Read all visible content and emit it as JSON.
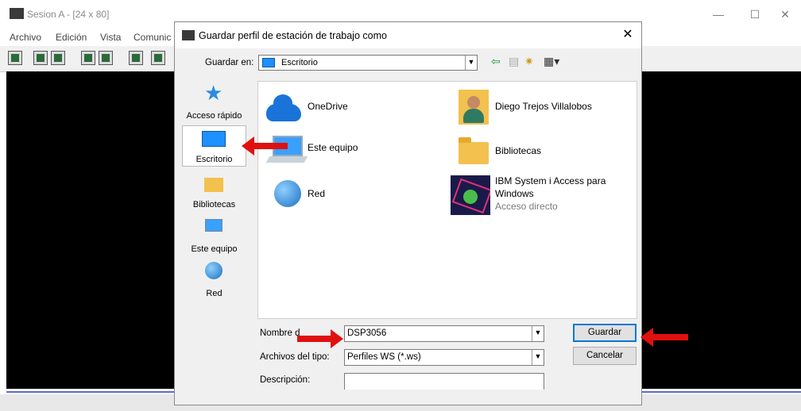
{
  "background_window": {
    "title": "Sesion A - [24 x 80]",
    "menu": [
      "Archivo",
      "Edición",
      "Vista",
      "Comunic"
    ],
    "controls": {
      "minimize": "—",
      "maximize": "☐",
      "close": "✕"
    }
  },
  "dialog": {
    "title": "Guardar perfil de estación de trabajo como",
    "close_symbol": "✕",
    "save_in_label": "Guardar en:",
    "save_in_value": "Escritorio",
    "places": [
      {
        "label": "Acceso rápido"
      },
      {
        "label": "Escritorio"
      },
      {
        "label": "Bibliotecas"
      },
      {
        "label": "Este equipo"
      },
      {
        "label": "Red"
      }
    ],
    "files": [
      {
        "name": "OneDrive"
      },
      {
        "name": "Este equipo"
      },
      {
        "name": "Red"
      },
      {
        "name": "Diego Trejos Villalobos"
      },
      {
        "name": "Bibliotecas"
      },
      {
        "name": "IBM System i Access para",
        "name2": "Windows",
        "sub": "Acceso directo"
      }
    ],
    "filename_label": "Nombre d",
    "filename_value": "DSP3056",
    "filetype_label": "Archivos del tipo:",
    "filetype_value": "Perfiles WS (*.ws)",
    "description_label": "Descripción:",
    "description_value": "",
    "save_button": "Guardar",
    "cancel_button": "Cancelar"
  }
}
